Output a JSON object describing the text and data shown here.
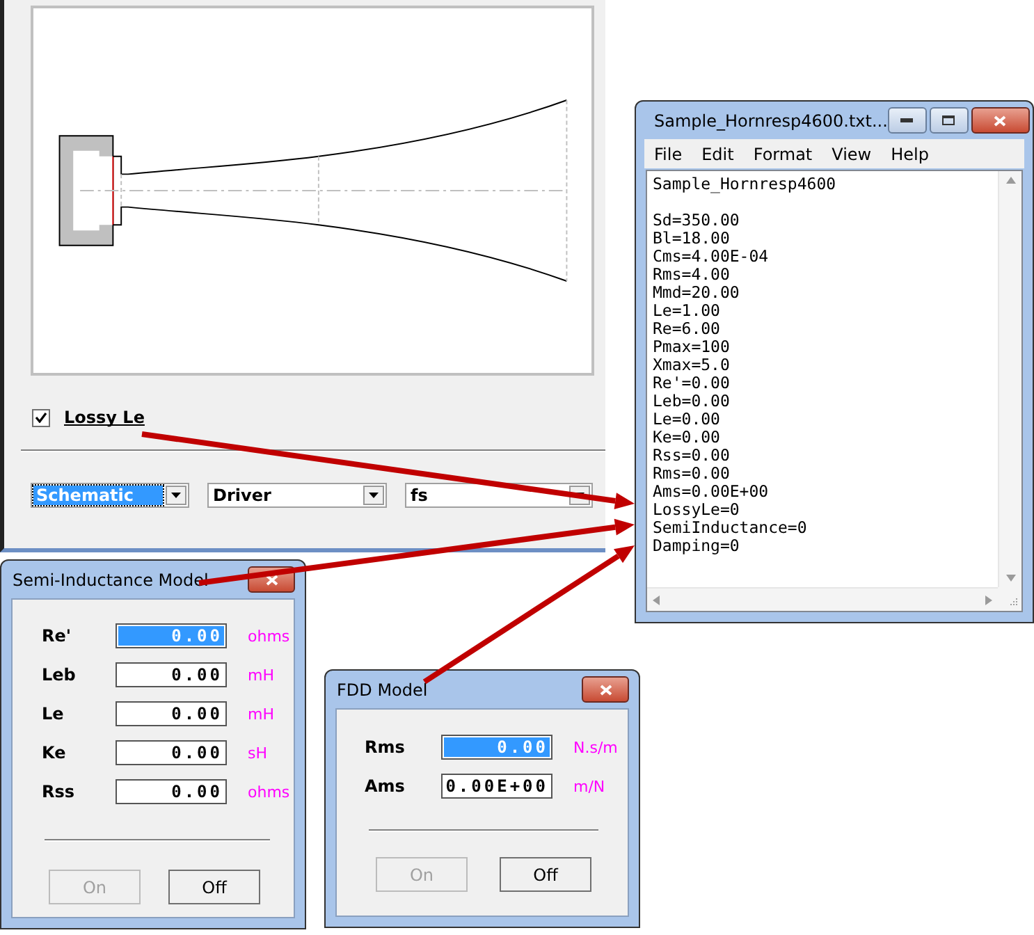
{
  "main_window": {
    "lossy_le": {
      "label": "Lossy Le",
      "checked": true
    },
    "combos": [
      {
        "value": "Schematic",
        "selected": true
      },
      {
        "value": "Driver",
        "selected": false
      },
      {
        "value": "fs",
        "selected": false
      }
    ]
  },
  "notepad": {
    "title": "Sample_Hornresp4600.txt...",
    "menu": [
      "File",
      "Edit",
      "Format",
      "View",
      "Help"
    ],
    "heading": "Sample_Hornresp4600",
    "lines": [
      "Sd=350.00",
      "Bl=18.00",
      "Cms=4.00E-04",
      "Rms=4.00",
      "Mmd=20.00",
      "Le=1.00",
      "Re=6.00",
      "Pmax=100",
      "Xmax=5.0",
      "Re'=0.00",
      "Leb=0.00",
      "Le=0.00",
      "Ke=0.00",
      "Rss=0.00",
      "Rms=0.00",
      "Ams=0.00E+00",
      "LossyLe=0",
      "SemiInductance=0",
      "Damping=0"
    ]
  },
  "semi_inductance_dialog": {
    "title": "Semi-Inductance Model",
    "fields": [
      {
        "label": "Re'",
        "value": "0.00",
        "unit": "ohms",
        "selected": true
      },
      {
        "label": "Leb",
        "value": "0.00",
        "unit": "mH",
        "selected": false
      },
      {
        "label": "Le",
        "value": "0.00",
        "unit": "mH",
        "selected": false
      },
      {
        "label": "Ke",
        "value": "0.00",
        "unit": "sH",
        "selected": false
      },
      {
        "label": "Rss",
        "value": "0.00",
        "unit": "ohms",
        "selected": false
      }
    ],
    "buttons": [
      {
        "label": "On",
        "disabled": true
      },
      {
        "label": "Off",
        "disabled": false
      }
    ]
  },
  "fdd_dialog": {
    "title": "FDD Model",
    "fields": [
      {
        "label": "Rms",
        "value": "0.00",
        "unit": "N.s/m",
        "selected": true
      },
      {
        "label": "Ams",
        "value": "0.00E+00",
        "unit": "m/N",
        "selected": false
      }
    ],
    "buttons": [
      {
        "label": "On",
        "disabled": true
      },
      {
        "label": "Off",
        "disabled": false
      }
    ]
  }
}
